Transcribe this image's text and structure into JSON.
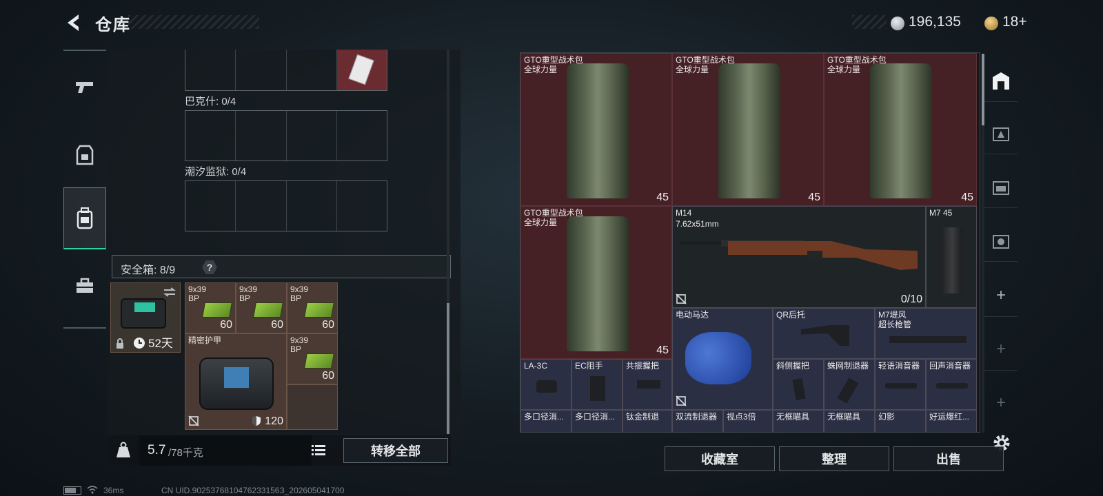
{
  "header": {
    "title": "仓库",
    "silver": "196,135",
    "gold": "18+"
  },
  "nav": {
    "items": [
      "weapon-tab",
      "armor-tab",
      "backpack-tab",
      "toolbox-tab"
    ],
    "active": 2
  },
  "left": {
    "cap1": "巴克什: 0/4",
    "cap2": "潮汐监狱: 0/4",
    "safe_label": "安全箱: 8/9",
    "safe_help": "?",
    "case_days": "52天",
    "ammo": [
      {
        "name": "9x39\nBP",
        "count": "60"
      },
      {
        "name": "9x39\nBP",
        "count": "60"
      },
      {
        "name": "9x39\nBP",
        "count": "60"
      },
      {
        "name": "9x39\nBP",
        "count": "60"
      }
    ],
    "armor_name": "精密护甲",
    "armor_count": "120",
    "weight": "5.7",
    "weight_total": "/78千克",
    "transfer_all": "转移全部"
  },
  "stash": {
    "bag_name": "GTO重型战术包",
    "bag_sub": "全球力量",
    "bag_count": "45",
    "m14_name": "M14",
    "m14_caliber": "7.62x51mm",
    "m14_count": "0/10",
    "m7_name": "M7 45",
    "motor_name": "电动马达",
    "qr_name": "QR后托",
    "m7barrel_name": "M7堤风\n超长枪管",
    "row_a": [
      "LA-3C",
      "EC阻手",
      "共振握把",
      "斜侧握把",
      "蛛网制退器",
      "轻语消音器",
      "回声消音器"
    ],
    "row_b": [
      "多口径消...",
      "多口径消...",
      "钛金制退",
      "双流制退器",
      "视点3倍",
      "无框瞄具",
      "无框瞄具",
      "幻影",
      "好运爆红..."
    ]
  },
  "buttons": {
    "collection": "收藏室",
    "tidy": "整理",
    "sell": "出售"
  },
  "status": {
    "ping": "36ms",
    "uid": "CN UID.9025376810476233156З_202605041700"
  },
  "colors": {
    "accent": "#2ad6a0",
    "item_red": "#452025",
    "item_blue": "#2a2f44"
  }
}
